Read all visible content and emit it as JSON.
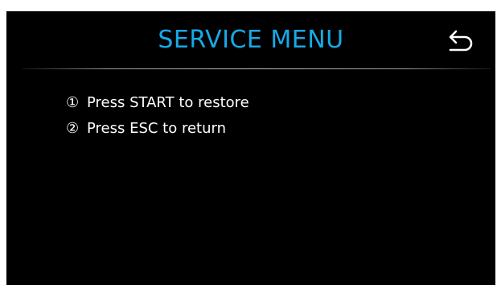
{
  "header": {
    "title": "SERVICE MENU",
    "back_icon": "back-arrow-icon"
  },
  "instructions": [
    {
      "number": "①",
      "text": "Press START to restore"
    },
    {
      "number": "②",
      "text": "Press ESC to return"
    }
  ],
  "colors": {
    "background": "#000000",
    "title": "#17a9e8",
    "text": "#ffffff"
  }
}
